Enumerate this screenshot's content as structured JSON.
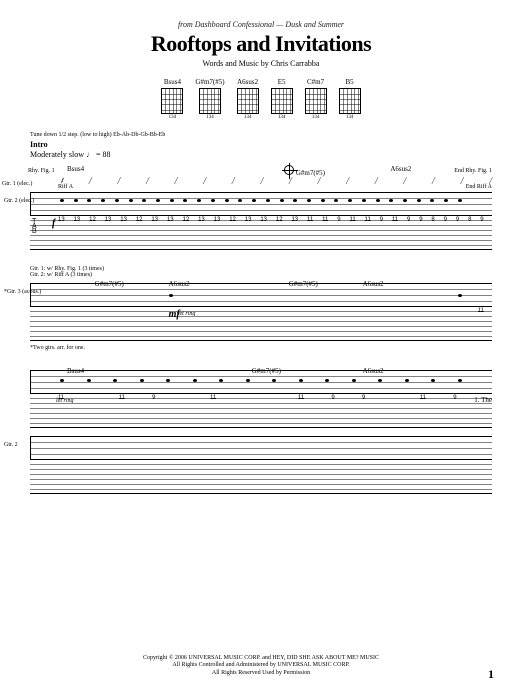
{
  "header": {
    "from_line": "from Dashboard Confessional — Dusk and Summer",
    "title": "Rooftops and Invitations",
    "credit": "Words and Music by Chris Carrabba"
  },
  "chord_diagrams": [
    {
      "name": "Bsus4",
      "fret": "134"
    },
    {
      "name": "G#m7(#5)",
      "fret": "134"
    },
    {
      "name": "A6sus2",
      "fret": "134"
    },
    {
      "name": "E5",
      "fret": "134"
    },
    {
      "name": "C#m7",
      "fret": "134"
    },
    {
      "name": "B5",
      "fret": "134"
    }
  ],
  "tuning_note": "Tune down 1/2 step. (low to high) Eb-Ab-Db-Gb-Bb-Eb",
  "intro_label": "Intro",
  "tempo": "Moderately slow ♩ = 88",
  "systems": [
    {
      "chords": [
        {
          "label": "Bsus4",
          "pos": "8%"
        },
        {
          "label": "G#m7(#5)",
          "pos": "57%",
          "coda": true
        },
        {
          "label": "A6sus2",
          "pos": "78%"
        }
      ],
      "rhy_label": "Rhy. Fig. 1",
      "end_rhy_label": "End Rhy. Fig. 1",
      "gtr1_label": "Gtr. 1 (elec.)",
      "gtr2_label": "Gtr. 2 (elec.)",
      "riff_label": "Riff A",
      "end_riff": "End Riff A",
      "dynamic": "f",
      "tab_row": [
        "13",
        "13",
        "12",
        "13",
        "13",
        "12",
        "13",
        "13",
        "12",
        "13",
        "13",
        "12",
        "13",
        "13",
        "12",
        "13",
        "11",
        "11",
        "9",
        "11",
        "11",
        "9",
        "11",
        "9",
        "9",
        "8",
        "9",
        "9",
        "8",
        "9"
      ]
    },
    {
      "chords": [
        {
          "label": "G#m7(#5)",
          "pos": "14%"
        },
        {
          "label": "A6sus2",
          "pos": "30%"
        },
        {
          "label": "G#m7(#5)",
          "pos": "56%"
        },
        {
          "label": "A6sus2",
          "pos": "72%"
        }
      ],
      "gtr_note": "Gtr. 1: w/ Rhy. Fig. 1 (3 times)\nGtr. 2: w/ Riff A (3 times)",
      "gtr3_label": "*Gtr. 3 (acous.)",
      "dynamic": "mf",
      "let_ring": "let ring",
      "footnote": "*Two gtrs. arr. for one.",
      "tab_row": [
        "",
        "",
        "",
        "",
        "",
        "",
        "",
        "",
        "",
        "11"
      ]
    },
    {
      "chords": [
        {
          "label": "Bsus4",
          "pos": "8%"
        },
        {
          "label": "G#m7(#5)",
          "pos": "48%"
        },
        {
          "label": "A6sus2",
          "pos": "72%"
        }
      ],
      "lyric": "1. The",
      "let_ring": "let ring",
      "tab_row": [
        "11",
        "",
        "11",
        "9",
        "",
        "11",
        "",
        "",
        "11",
        "9",
        "9",
        "",
        "11",
        "9",
        "",
        "",
        "",
        "",
        "",
        "",
        "",
        "",
        "",
        "",
        "",
        "",
        ""
      ]
    }
  ],
  "gtr2_staff2_label": "Gtr. 2",
  "copyright": {
    "line1": "Copyright © 2006 UNIVERSAL MUSIC CORP. and HEY, DID SHE ASK ABOUT ME? MUSIC",
    "line2": "All Rights Controlled and Administered by UNIVERSAL MUSIC CORP.",
    "line3": "All Rights Reserved   Used by Permission"
  },
  "page_num": "1"
}
